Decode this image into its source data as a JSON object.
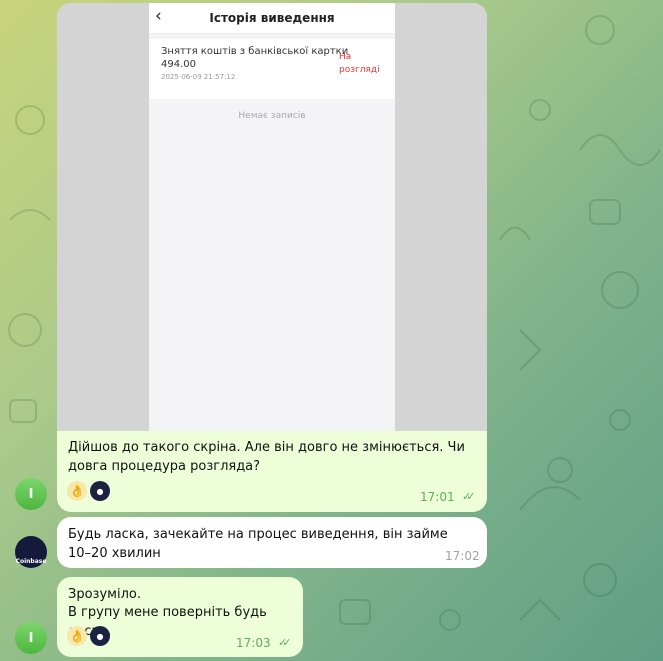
{
  "screenshot": {
    "back_icon": "chevron-left-icon",
    "title": "Історія виведення",
    "item": {
      "title": "Зняття коштів з банківської картки",
      "amount": "494.00",
      "date": "2025-06-09 21:57:12",
      "status": "На розгляді",
      "status_color": "#e53935"
    },
    "empty_text": "Немає записів"
  },
  "messages": [
    {
      "direction": "out",
      "text": "Дійшов до такого скріна. Але він довго не змінюється. Чи довга процедура розгляда?",
      "time": "17:01",
      "reactions": [
        "👌",
        "avatar"
      ]
    },
    {
      "direction": "in",
      "text": "Будь ласка, зачекайте на процес виведення, він займе 10–20 хвилин",
      "time": "17:02"
    },
    {
      "direction": "out",
      "text_line1": "Зрозуміло.",
      "text_line2": "В групу мене поверніть будь ласка.",
      "time": "17:03",
      "reactions": [
        "👌",
        "avatar"
      ]
    }
  ],
  "avatars": {
    "user_letter": "I",
    "support_label": "Coinbase"
  },
  "colors": {
    "outgoing_bubble": "#eefed9",
    "incoming_bubble": "#ffffff",
    "read_check": "#5fae5a"
  }
}
